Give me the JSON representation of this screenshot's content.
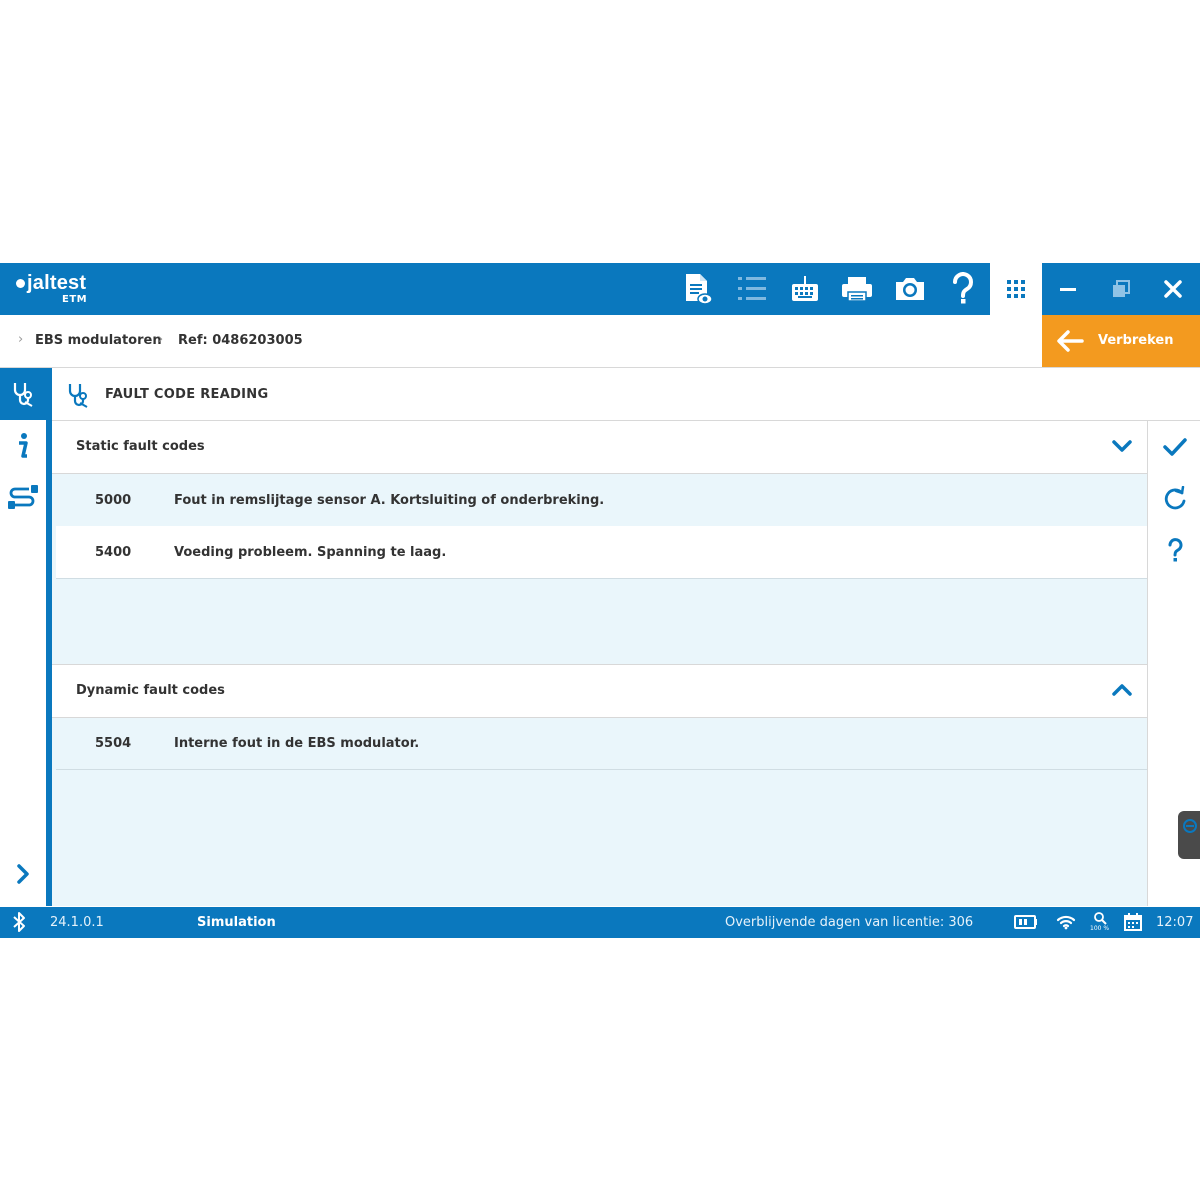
{
  "app": {
    "logo_text": "jaltest",
    "logo_sub": "ETM"
  },
  "toolbar": {
    "icons": [
      "report-view-icon",
      "list-icon",
      "keyboard-icon",
      "printer-icon",
      "camera-icon",
      "help-icon",
      "apps-grid-icon"
    ]
  },
  "window_controls": [
    "minimize-icon",
    "restore-icon",
    "close-icon"
  ],
  "breadcrumb": {
    "items": [
      "EBS modulatoren",
      "Ref: 0486203005"
    ]
  },
  "disconnect": {
    "label": "Verbreken",
    "color": "#f39a1f"
  },
  "section": {
    "title": "FAULT CODE READING"
  },
  "static_faults": {
    "title": "Static fault codes",
    "rows": [
      {
        "code": "5000",
        "description": "Fout in remslijtage sensor A. Kortsluiting of onderbreking."
      },
      {
        "code": "5400",
        "description": "Voeding probleem. Spanning te laag."
      }
    ]
  },
  "dynamic_faults": {
    "title": "Dynamic fault codes",
    "rows": [
      {
        "code": "5504",
        "description": "Interne fout in de EBS modulator."
      }
    ]
  },
  "statusbar": {
    "version": "24.1.0.1",
    "mode": "Simulation",
    "license": "Overblijvende dagen van licentie: 306",
    "zoom": "100 %",
    "time": "12:07"
  },
  "colors": {
    "primary": "#0a78be",
    "accent": "#f39a1f",
    "content_bg": "#eaf6fb"
  }
}
